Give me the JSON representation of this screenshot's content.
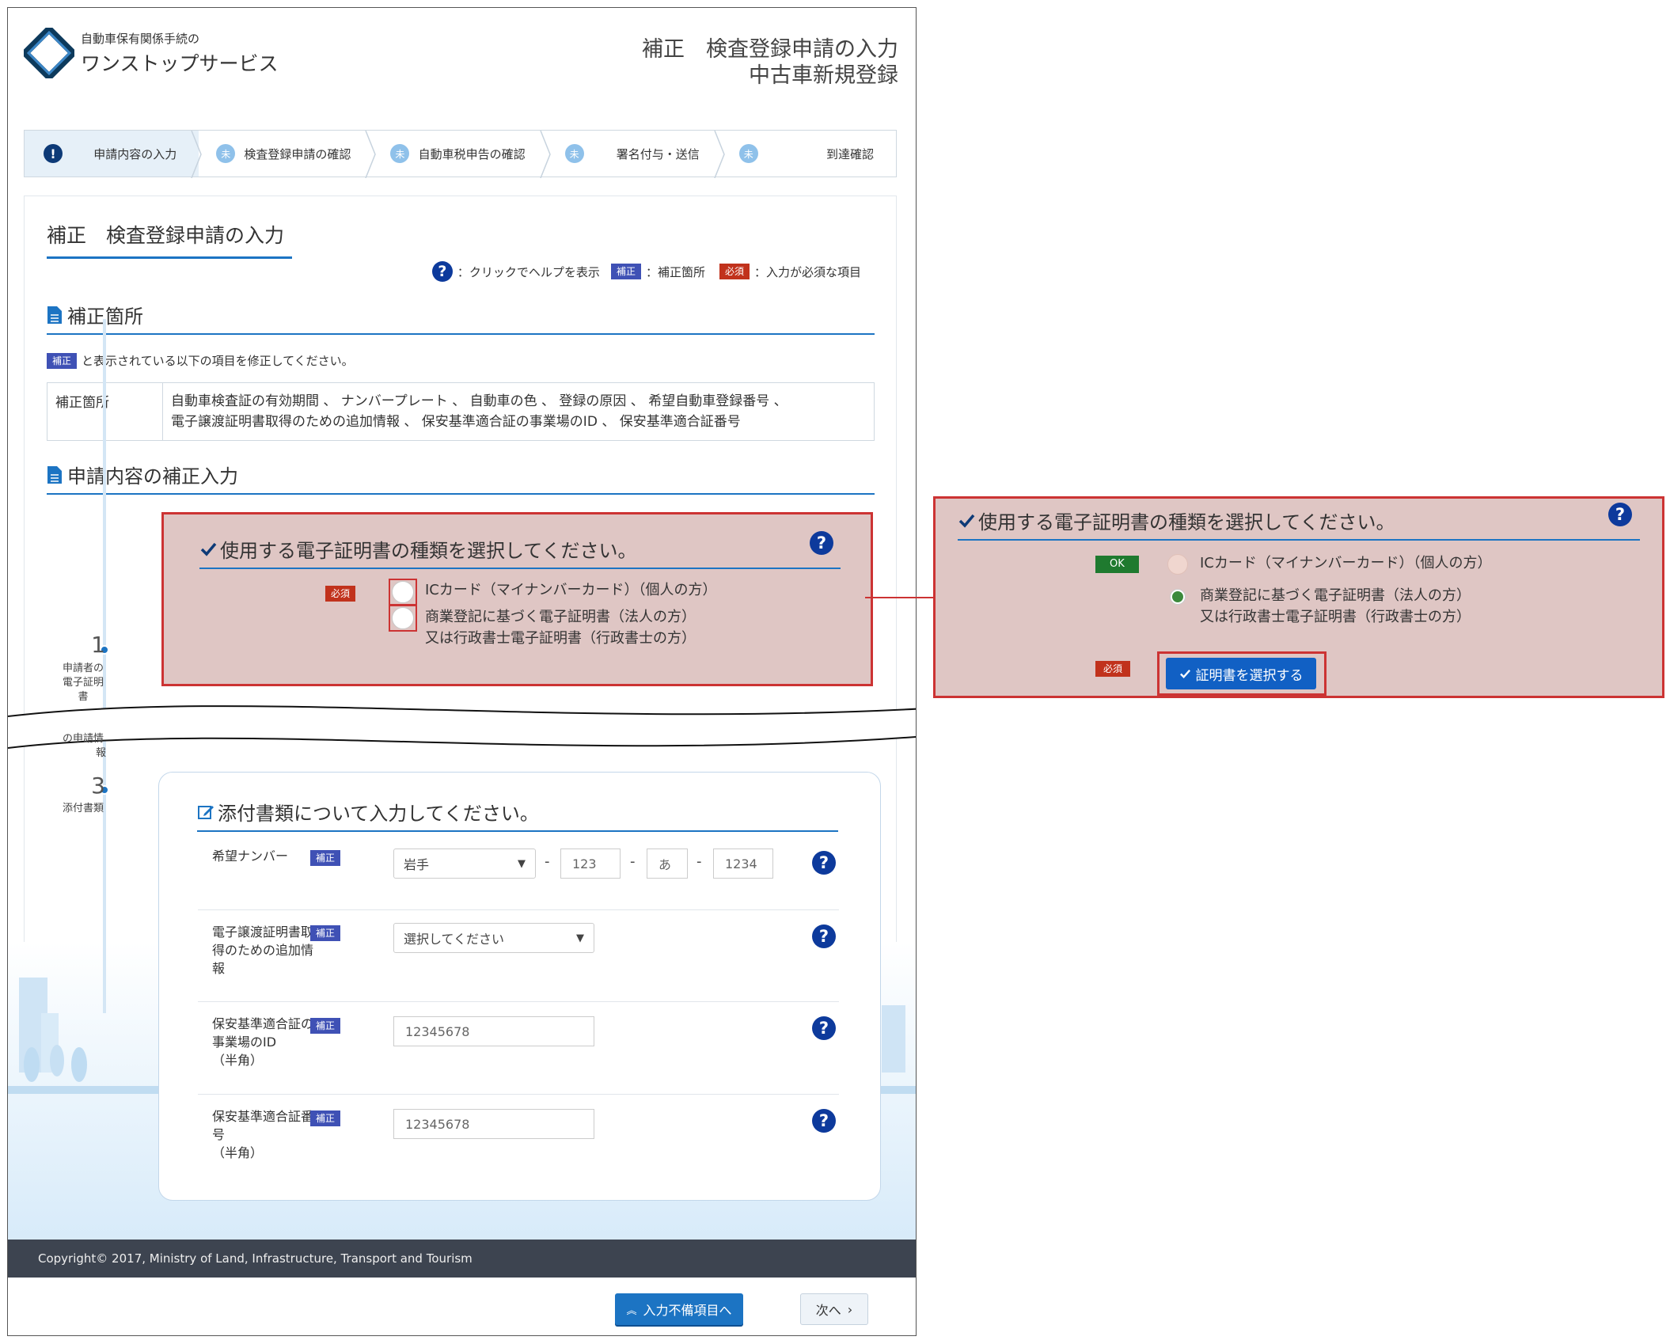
{
  "header": {
    "logo_sub": "自動車保有関係手続の",
    "logo_main": "ワンストップサービス",
    "title_line1": "補正　検査登録申請の入力",
    "title_line2": "中古車新規登録"
  },
  "steps": [
    {
      "icon": "!",
      "label": "申請内容の入力",
      "state": "current"
    },
    {
      "icon": "未",
      "label": "検査登録申請の確認",
      "state": "pending"
    },
    {
      "icon": "未",
      "label": "自動車税申告の確認",
      "state": "pending"
    },
    {
      "icon": "未",
      "label": "署名付与・送信",
      "state": "pending"
    },
    {
      "icon": "未",
      "label": "到達確認",
      "state": "pending"
    }
  ],
  "page_title": "補正　検査登録申請の入力",
  "legend": {
    "help_text": "：クリックでヘルプを表示",
    "hosei_badge": "補正",
    "hosei_text": "：補正箇所",
    "hissu_badge": "必須",
    "hissu_text": "：入力が必須な項目"
  },
  "section_correction": {
    "title": "補正箇所",
    "note_badge": "補正",
    "note_text": "と表示されている以下の項目を修正してください。",
    "table_header": "補正箇所",
    "table_line1": "自動車検査証の有効期間 、 ナンバープレート 、 自動車の色 、 登録の原因 、 希望自動車登録番号 、",
    "table_line2": "電子譲渡証明書取得のための追加情報 、 保安基準適合証の事業場のID 、 保安基準適合証番号"
  },
  "section_input": {
    "title": "申請内容の補正入力"
  },
  "timeline": {
    "step1_num": "1",
    "step1_label_a": "申請者の",
    "step1_label_b": "電子証明",
    "step1_label_c": "書",
    "step2_label_a": "の申請情",
    "step2_label_b": "報",
    "step3_num": "3",
    "step3_label": "添付書類"
  },
  "cert_panel": {
    "title": "使用する電子証明書の種類を選択してください。",
    "required_badge": "必須",
    "option1": "ICカード（マイナンバーカード）（個人の方）",
    "option2_line1": "商業登記に基づく電子証明書（法人の方）",
    "option2_line2": "又は行政書士電子証明書（行政書士の方）"
  },
  "zoom_panel": {
    "title": "使用する電子証明書の種類を選択してください。",
    "ok_badge": "OK",
    "required_badge": "必須",
    "option1": "ICカード（マイナンバーカード）（個人の方）",
    "option2_line1": "商業登記に基づく電子証明書（法人の方）",
    "option2_line2": "又は行政書士電子証明書（行政書士の方）",
    "select_cert_button": "証明書を選択する",
    "selected_option": 2
  },
  "attach_panel": {
    "title": "添付書類について入力してください。",
    "rows": [
      {
        "label": "希望ナンバー",
        "badge": "補正"
      },
      {
        "label": "電子譲渡証明書取得のための追加情報",
        "badge": "補正"
      },
      {
        "label": "保安基準適合証の事業場のID（半角）",
        "badge": "補正"
      },
      {
        "label": "保安基準適合証番号（半角）",
        "badge": "補正"
      }
    ],
    "row1_label": "希望ナンバー",
    "row2_label_a": "電子譲渡証明書取",
    "row2_label_b": "得のための追加情",
    "row2_label_c": "報",
    "row3_label_a": "保安基準適合証の",
    "row3_label_b": "事業場のID",
    "row3_label_c": "（半角）",
    "row4_label_a": "保安基準適合証番",
    "row4_label_b": "号",
    "row4_label_c": "（半角）",
    "hosei_badge": "補正",
    "plate_region": "岩手",
    "plate_class": "123",
    "plate_kana": "あ",
    "plate_number": "1234",
    "plate_dash": "-",
    "additional_info_select": "選択してください",
    "workplace_id": "12345678",
    "certificate_number": "12345678"
  },
  "footer": {
    "copyright": "Copyright© 2017, Ministry of Land, Infrastructure, Transport and Tourism"
  },
  "buttons": {
    "incomplete": "入力不備項目へ",
    "next": "次へ"
  },
  "colors": {
    "primary": "#1c74c3",
    "hosei": "#3f51b5",
    "hissu": "#c1321c",
    "ok": "#1f7a2f",
    "highlight": "#cc3333",
    "footer": "#3d4450"
  }
}
